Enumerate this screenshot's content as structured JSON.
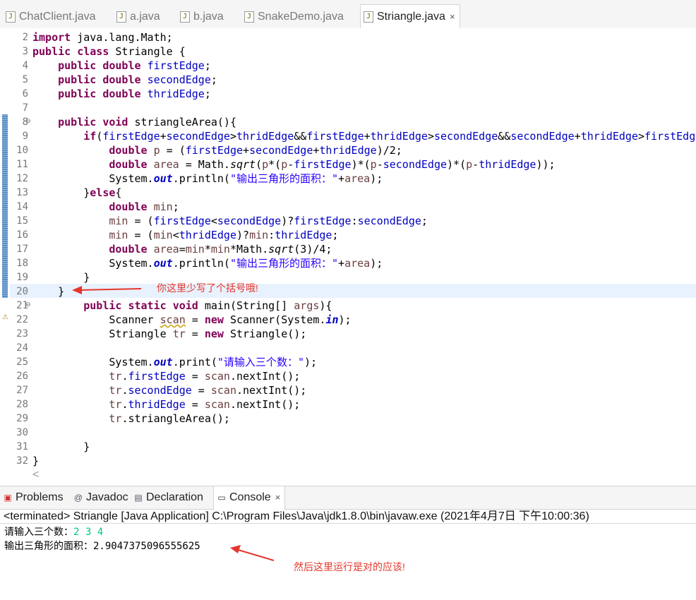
{
  "editor_tabs": [
    {
      "label": "ChatClient.java",
      "active": false
    },
    {
      "label": "a.java",
      "active": false
    },
    {
      "label": "b.java",
      "active": false
    },
    {
      "label": "SnakeDemo.java",
      "active": false
    },
    {
      "label": "Striangle.java",
      "active": true
    }
  ],
  "tab_close_glyph": "×",
  "java_icon": "java-file-icon",
  "code": {
    "line_numbers": [
      "2",
      "3",
      "4",
      "5",
      "6",
      "7",
      "8",
      "9",
      "10",
      "11",
      "12",
      "13",
      "14",
      "15",
      "16",
      "17",
      "18",
      "19",
      "20",
      "21",
      "22",
      "23",
      "24",
      "25",
      "26",
      "27",
      "28",
      "29",
      "30",
      "31",
      "32"
    ],
    "lines": [
      "import java.lang.Math;",
      "public class Striangle {",
      "    public double firstEdge;",
      "    public double secondEdge;",
      "    public double thridEdge;",
      "",
      "    public void striangleArea(){",
      "        if(firstEdge+secondEdge>thridEdge&&firstEdge+thridEdge>secondEdge&&secondEdge+thridEdge>firstEdge",
      "            double p = (firstEdge+secondEdge+thridEdge)/2;",
      "            double area = Math.sqrt(p*(p-firstEdge)*(p-secondEdge)*(p-thridEdge));",
      "            System.out.println(\"输出三角形的面积：\"+area);",
      "        }else{",
      "            double min;",
      "            min = (firstEdge<secondEdge)?firstEdge:secondEdge;",
      "            min = (min<thridEdge)?min:thridEdge;",
      "            double area=min*min*Math.sqrt(3)/4;",
      "            System.out.println(\"输出三角形的面积：\"+area);",
      "        }",
      "    }",
      "        public static void main(String[] args){",
      "            Scanner scan = new Scanner(System.in);",
      "            Striangle tr = new Striangle();",
      "",
      "            System.out.print(\"请输入三个数：\");",
      "            tr.firstEdge = scan.nextInt();",
      "            tr.secondEdge = scan.nextInt();",
      "            tr.thridEdge = scan.nextInt();",
      "            tr.striangleArea();",
      "",
      "        }",
      "}"
    ]
  },
  "annotations": {
    "editor_note": "你这里少写了个括号哦!",
    "console_note": "然后这里运行是对的应该!"
  },
  "view_tabs": [
    {
      "label": "Problems",
      "icon": "problems-icon",
      "active": false
    },
    {
      "label": "Javadoc",
      "icon": "javadoc-icon",
      "active": false
    },
    {
      "label": "Declaration",
      "icon": "declaration-icon",
      "active": false
    },
    {
      "label": "Console",
      "icon": "console-icon",
      "active": true
    }
  ],
  "console": {
    "header": "<terminated> Striangle [Java Application] C:\\Program Files\\Java\\jdk1.8.0\\bin\\javaw.exe (2021年4月7日 下午10:00:36)",
    "prompt": "请输入三个数：",
    "user_input": "2 3 4",
    "output": "输出三角形的面积：2.9047375096555625"
  },
  "colors": {
    "keyword": "#7f0055",
    "field": "#0000c0",
    "string": "#2a00ff",
    "annotation": "#e5362c",
    "console_input": "#00c87d",
    "current_line": "#e8f2fe"
  }
}
